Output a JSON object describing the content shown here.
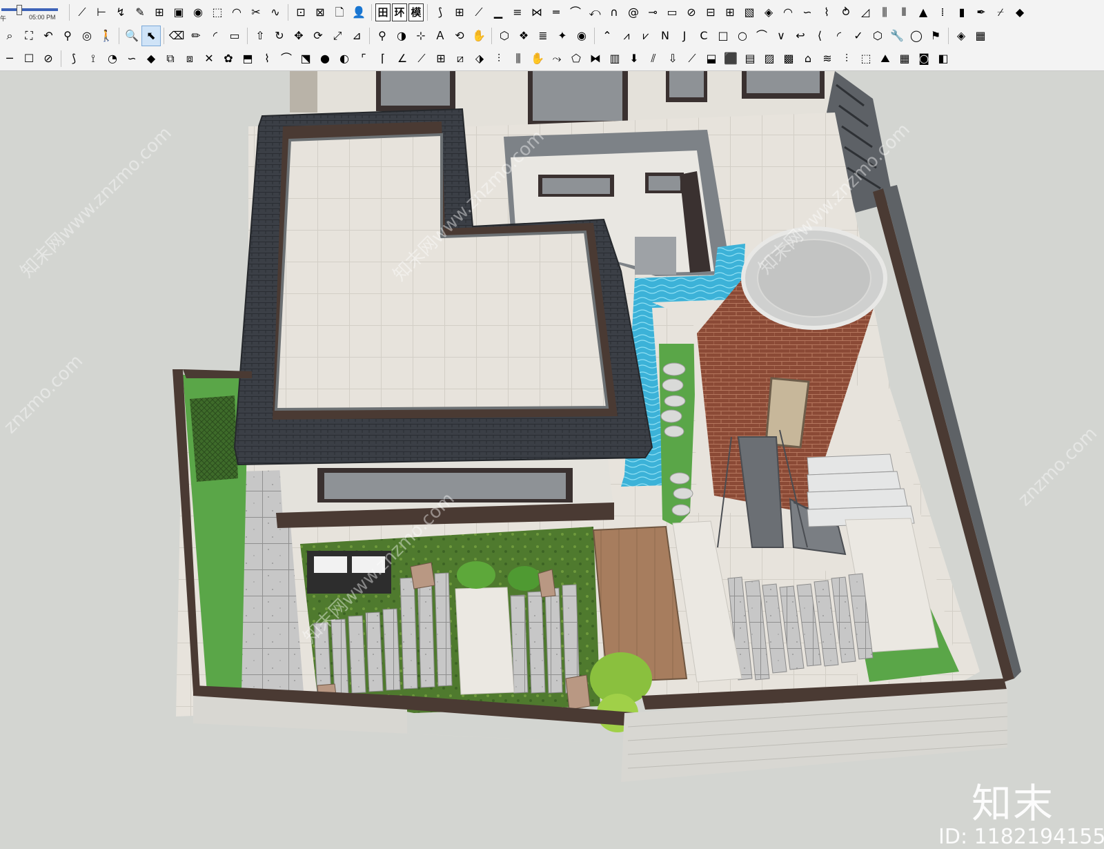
{
  "toolbar": {
    "shadow_widget": {
      "am_label": "午",
      "time": "05:00 PM"
    },
    "row1_left": [
      {
        "name": "line-tool",
        "glyph": "⟋"
      },
      {
        "name": "dimension-tool",
        "glyph": "⊢"
      },
      {
        "name": "follow-me-tool",
        "glyph": "↯"
      },
      {
        "name": "eraser-brush",
        "glyph": "✎"
      },
      {
        "name": "outliner",
        "glyph": "⊞"
      },
      {
        "name": "material-box",
        "glyph": "▣"
      },
      {
        "name": "paint-bucket",
        "glyph": "◉"
      },
      {
        "name": "map-tool",
        "glyph": "⬚"
      },
      {
        "name": "soften",
        "glyph": "◠"
      },
      {
        "name": "scissors-cut",
        "glyph": "✂"
      },
      {
        "name": "sandbox-smoove",
        "glyph": "∿"
      }
    ],
    "row1_mid": [
      {
        "name": "section-plane",
        "glyph": "⊡"
      },
      {
        "name": "section-display",
        "glyph": "⊠"
      },
      {
        "name": "new-file",
        "glyph": "🗋"
      },
      {
        "name": "user-account",
        "glyph": "👤"
      }
    ],
    "row1_text": [
      {
        "name": "grid-button",
        "text": "田"
      },
      {
        "name": "env-button",
        "text": "环"
      },
      {
        "name": "model-button",
        "text": "模"
      }
    ],
    "row1_right": [
      {
        "name": "stair-tool",
        "glyph": "⟆"
      },
      {
        "name": "railing-tool",
        "glyph": "⊞"
      },
      {
        "name": "ramp-tool",
        "glyph": "⟋"
      },
      {
        "name": "steps-tool",
        "glyph": "▁"
      },
      {
        "name": "plank-tool",
        "glyph": "≡"
      },
      {
        "name": "joint-tool",
        "glyph": "⋈"
      },
      {
        "name": "flatten-tool",
        "glyph": "═"
      },
      {
        "name": "bend-tool",
        "glyph": "⌒"
      },
      {
        "name": "twist-tool",
        "glyph": "⤺"
      },
      {
        "name": "arch-tool",
        "glyph": "∩"
      },
      {
        "name": "spiral-tool",
        "glyph": "@"
      },
      {
        "name": "measure-tool",
        "glyph": "⊸"
      },
      {
        "name": "slab-tool",
        "glyph": "▭"
      },
      {
        "name": "pivot-tool",
        "glyph": "⊘"
      },
      {
        "name": "grid-tool",
        "glyph": "⊟"
      },
      {
        "name": "tile-tool",
        "glyph": "⊞"
      },
      {
        "name": "box-tool",
        "glyph": "▧"
      },
      {
        "name": "cube-tool",
        "glyph": "◈"
      },
      {
        "name": "dome-tool",
        "glyph": "◠"
      },
      {
        "name": "wave-tool",
        "glyph": "∽"
      },
      {
        "name": "curve-tool",
        "glyph": "⌇"
      },
      {
        "name": "swirl-tool",
        "glyph": "⥁"
      },
      {
        "name": "triangle-tool",
        "glyph": "◿"
      },
      {
        "name": "fence-tool",
        "glyph": "⫼"
      },
      {
        "name": "column-tool",
        "glyph": "⫴"
      },
      {
        "name": "pyramid-tool",
        "glyph": "▲"
      },
      {
        "name": "dots-tool",
        "glyph": "⁞"
      },
      {
        "name": "door-tool",
        "glyph": "▮"
      },
      {
        "name": "pen-tool",
        "glyph": "✒"
      },
      {
        "name": "sweep-tool",
        "glyph": "⌿"
      },
      {
        "name": "sketchup-logo",
        "glyph": "◆"
      }
    ],
    "row2": [
      {
        "name": "zoom-extents",
        "glyph": "⌕"
      },
      {
        "name": "zoom-window",
        "glyph": "⛶"
      },
      {
        "name": "previous-view",
        "glyph": "↶"
      },
      {
        "name": "walk-tool",
        "glyph": "⚲"
      },
      {
        "name": "look-around",
        "glyph": "◎"
      },
      {
        "name": "walk-person",
        "glyph": "🚶"
      },
      {
        "name": "sep",
        "glyph": ""
      },
      {
        "name": "zoom-tool",
        "glyph": "🔍"
      },
      {
        "name": "select-tool",
        "glyph": "⬉",
        "active": true
      },
      {
        "name": "sep",
        "glyph": ""
      },
      {
        "name": "eraser-tool",
        "glyph": "⌫"
      },
      {
        "name": "pencil-tool",
        "glyph": "✏"
      },
      {
        "name": "arc-tool",
        "glyph": "◜"
      },
      {
        "name": "rectangle-tool",
        "glyph": "▭"
      },
      {
        "name": "sep",
        "glyph": ""
      },
      {
        "name": "push-pull",
        "glyph": "⇧"
      },
      {
        "name": "follow-me",
        "glyph": "↻"
      },
      {
        "name": "move-tool",
        "glyph": "✥"
      },
      {
        "name": "rotate-tool",
        "glyph": "⟳"
      },
      {
        "name": "scale-tool",
        "glyph": "⤢"
      },
      {
        "name": "offset-tool",
        "glyph": "⊿"
      },
      {
        "name": "sep",
        "glyph": ""
      },
      {
        "name": "tape-measure",
        "glyph": "⚲"
      },
      {
        "name": "protractor",
        "glyph": "◑"
      },
      {
        "name": "axes-tool",
        "glyph": "⊹"
      },
      {
        "name": "text-tool",
        "glyph": "Ａ"
      },
      {
        "name": "orbit-tool",
        "glyph": "⟲"
      },
      {
        "name": "pan-tool",
        "glyph": "✋"
      },
      {
        "name": "sep",
        "glyph": ""
      },
      {
        "name": "component-tool",
        "glyph": "⬡"
      },
      {
        "name": "group-tool",
        "glyph": "❖"
      },
      {
        "name": "layers-tool",
        "glyph": "≣"
      },
      {
        "name": "styles-tool",
        "glyph": "✦"
      },
      {
        "name": "profile-tool",
        "glyph": "◉"
      },
      {
        "name": "sep",
        "glyph": ""
      },
      {
        "name": "draw-arc-1",
        "glyph": "⌃"
      },
      {
        "name": "draw-zig",
        "glyph": "⩘"
      },
      {
        "name": "draw-zag",
        "glyph": "⩗"
      },
      {
        "name": "draw-n",
        "glyph": "Ν"
      },
      {
        "name": "draw-j",
        "glyph": "Ϳ"
      },
      {
        "name": "draw-c",
        "glyph": "Ϲ"
      },
      {
        "name": "draw-square",
        "glyph": "□"
      },
      {
        "name": "draw-circle",
        "glyph": "○"
      },
      {
        "name": "draw-curve",
        "glyph": "⌒"
      },
      {
        "name": "draw-v",
        "glyph": "∨"
      },
      {
        "name": "draw-hook",
        "glyph": "↩"
      },
      {
        "name": "draw-bracket",
        "glyph": "⟨"
      },
      {
        "name": "draw-arc-2",
        "glyph": "◜"
      },
      {
        "name": "draw-check",
        "glyph": "✓"
      },
      {
        "name": "draw-polygon",
        "glyph": "⬡"
      },
      {
        "name": "wrench-tool",
        "glyph": "🔧"
      },
      {
        "name": "ellipse-tool",
        "glyph": "◯"
      },
      {
        "name": "flag-tool",
        "glyph": "⚑"
      },
      {
        "name": "sep",
        "glyph": ""
      },
      {
        "name": "render-tool",
        "glyph": "◈"
      },
      {
        "name": "grid-render",
        "glyph": "▦"
      }
    ],
    "row3": [
      {
        "name": "line-style",
        "glyph": "─"
      },
      {
        "name": "box-style",
        "glyph": "☐"
      },
      {
        "name": "hide-tool",
        "glyph": "⊘"
      },
      {
        "name": "sep",
        "glyph": ""
      },
      {
        "name": "spline-tool",
        "glyph": "⟆"
      },
      {
        "name": "polyline-tool",
        "glyph": "⟟"
      },
      {
        "name": "circle-add",
        "glyph": "◔"
      },
      {
        "name": "bezier-tool",
        "glyph": "∽"
      },
      {
        "name": "fill-tool",
        "glyph": "◆"
      },
      {
        "name": "stack-tool",
        "glyph": "⧉"
      },
      {
        "name": "layer-tool",
        "glyph": "⧈"
      },
      {
        "name": "cross-tool",
        "glyph": "✕"
      },
      {
        "name": "smooth-tool",
        "glyph": "✿"
      },
      {
        "name": "extrude-tool",
        "glyph": "⬒"
      },
      {
        "name": "loft-tool",
        "glyph": "⌇"
      },
      {
        "name": "bend-tool-2",
        "glyph": "⌒"
      },
      {
        "name": "shell-tool",
        "glyph": "⬔"
      },
      {
        "name": "sphere-tool",
        "glyph": "●"
      },
      {
        "name": "split-tool",
        "glyph": "◐"
      },
      {
        "name": "corner-tool",
        "glyph": "⌜"
      },
      {
        "name": "fillet-tool",
        "glyph": "⌈"
      },
      {
        "name": "angle-tool",
        "glyph": "∠"
      },
      {
        "name": "trim-tool",
        "glyph": "⟋"
      },
      {
        "name": "array-tool",
        "glyph": "⊞"
      },
      {
        "name": "cut-tool",
        "glyph": "⧄"
      },
      {
        "name": "pick-tool",
        "glyph": "⬗"
      },
      {
        "name": "shadow-tool",
        "glyph": "⫶"
      },
      {
        "name": "column-array",
        "glyph": "⫼"
      },
      {
        "name": "hand-tool",
        "glyph": "✋"
      },
      {
        "name": "sweep-2",
        "glyph": "⤳"
      },
      {
        "name": "shape-tool",
        "glyph": "⬠"
      },
      {
        "name": "intersect-tool",
        "glyph": "⧓"
      },
      {
        "name": "wall-tool",
        "glyph": "▥"
      },
      {
        "name": "arrow-down",
        "glyph": "⬇"
      },
      {
        "name": "rebar-tool",
        "glyph": "⫽"
      },
      {
        "name": "down-arrow-2",
        "glyph": "⇩"
      },
      {
        "name": "slope-tool",
        "glyph": "⟋"
      },
      {
        "name": "ceiling-tool",
        "glyph": "⬓"
      },
      {
        "name": "beam-tool",
        "glyph": "⬛"
      },
      {
        "name": "floor-tool",
        "glyph": "▤"
      },
      {
        "name": "texture-tool",
        "glyph": "▨"
      },
      {
        "name": "hatch-tool",
        "glyph": "▩"
      },
      {
        "name": "roof-tool",
        "glyph": "⌂"
      },
      {
        "name": "louver-tool",
        "glyph": "≋"
      },
      {
        "name": "stripes-tool",
        "glyph": "⫶"
      },
      {
        "name": "box-3d",
        "glyph": "⬚"
      },
      {
        "name": "terrain-tool",
        "glyph": "⛰"
      },
      {
        "name": "grass-tool",
        "glyph": "▦"
      },
      {
        "name": "green-tool",
        "glyph": "◙"
      },
      {
        "name": "red-tool",
        "glyph": "◧"
      }
    ]
  },
  "viewport": {
    "background": "#d3d5d1",
    "colors": {
      "wall_top": "#4a3a33",
      "wall_inner": "#6b7073",
      "wall_outer": "#d8d7d2",
      "roof_tile": "#3b3f46",
      "roof_edge": "#25282c",
      "floor_beige": "#e6e2da",
      "grass": "#5da84a",
      "water": "#3fb3d6",
      "brick": "#8c4a36",
      "stone": "#c6c6c6",
      "wood_deck": "#a27a5c"
    }
  },
  "watermarks": {
    "logo": "知末",
    "id_text": "ID: 1182194155",
    "diagonal": "知末网www.znzmo.com",
    "diagonal_short": "znzmo.com"
  }
}
